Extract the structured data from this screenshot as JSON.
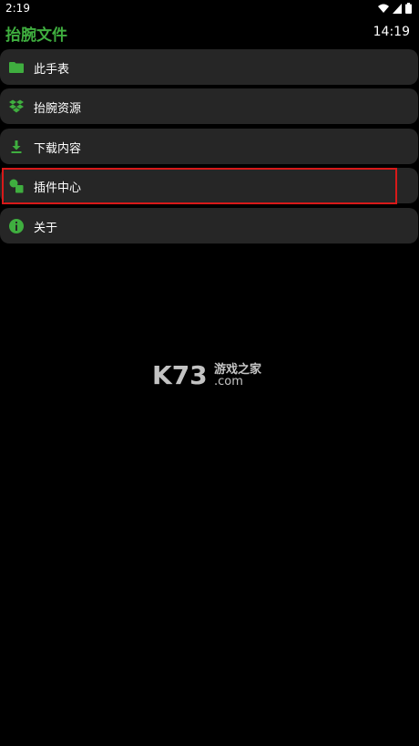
{
  "status_bar": {
    "time": "2:19",
    "icons": [
      "wifi-icon",
      "signal-icon",
      "battery-icon"
    ]
  },
  "header": {
    "title": "抬腕文件",
    "clock": "14:19"
  },
  "menu": {
    "items": [
      {
        "label": "此手表",
        "icon": "folder-icon"
      },
      {
        "label": "抬腕资源",
        "icon": "dropbox-icon"
      },
      {
        "label": "下载内容",
        "icon": "download-icon"
      },
      {
        "label": "插件中心",
        "icon": "plugin-icon"
      },
      {
        "label": "关于",
        "icon": "info-icon"
      }
    ]
  },
  "watermark": {
    "brand": "K73",
    "site_cn": "游戏之家",
    "domain": ".com"
  },
  "colors": {
    "accent": "#3fae3f",
    "item_bg": "#262626",
    "highlight": "#d81919",
    "background": "#000000"
  }
}
